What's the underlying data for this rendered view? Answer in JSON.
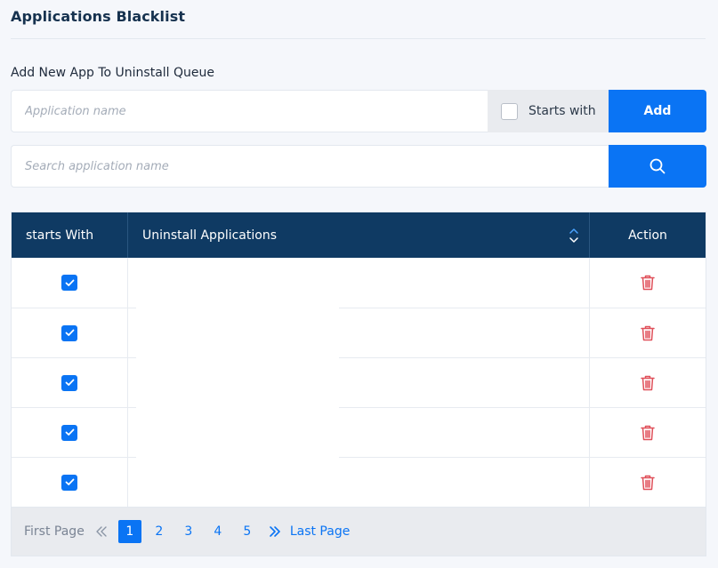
{
  "page": {
    "title": "Applications Blacklist",
    "section_label": "Add New App To Uninstall Queue"
  },
  "add_form": {
    "placeholder": "Application name",
    "starts_with_label": "Starts with",
    "add_label": "Add"
  },
  "search": {
    "placeholder": "Search application name"
  },
  "table": {
    "headers": {
      "starts_with": "starts With",
      "applications": "Uninstall Applications",
      "action": "Action"
    },
    "rows": [
      {
        "starts_with": true,
        "app": ""
      },
      {
        "starts_with": true,
        "app": ""
      },
      {
        "starts_with": true,
        "app": ""
      },
      {
        "starts_with": true,
        "app": ""
      },
      {
        "starts_with": true,
        "app": ""
      }
    ]
  },
  "pagination": {
    "first_label": "First Page",
    "last_label": "Last Page",
    "pages": [
      "1",
      "2",
      "3",
      "4",
      "5"
    ],
    "current": "1"
  },
  "colors": {
    "accent": "#0a74f4",
    "header_bg": "#0f3a63",
    "delete": "#e0505a"
  },
  "icons": {
    "search": "search-icon",
    "sort": "sort-icon",
    "delete": "trash-icon",
    "prev": "double-chevron-left-icon",
    "next": "double-chevron-right-icon"
  }
}
